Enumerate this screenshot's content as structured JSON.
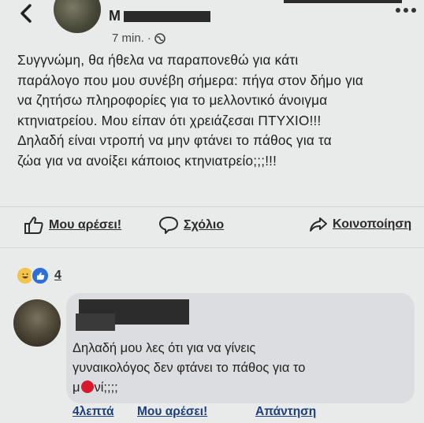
{
  "header": {
    "author_initial": "M",
    "time": "7 min.",
    "separator": "·"
  },
  "post": {
    "lines": [
      "Συγγνώμη, θα ήθελα να παραπονεθώ για κάτι",
      "παράλογο που μου συνέβη σήμερα: πήγα στον δήμο για",
      "να ζητήσω πληροφορίες για το μελλοντικό άνοιγμα",
      "κτηνιατρείου. Μου είπαν ότι χρειάζεσαι ΠΤΥΧΙΟ!!!",
      "Δηλαδή είναι ντροπή να μην φτάνει το πάθος για τα",
      "ζώα για να ανοίξει κάποιος κτηνιατρείο;;;!!!"
    ]
  },
  "actions": {
    "like_label": "Μου αρέσει!",
    "comment_label": "Σχόλιο",
    "share_label": "Κοινοποίηση"
  },
  "reactions": {
    "count": "4"
  },
  "comment": {
    "line1": "Δηλαδή μου λες ότι για να γίνεις",
    "line2": "γυναικολόγος δεν φτάνει το πάθος για το",
    "line3_start": "μ",
    "line3_end": "νί;;;;",
    "time_label": "4λεπτά",
    "like_label": "Μου αρέσει!",
    "reply_label": "Απάντηση"
  },
  "colors": {
    "background": "#e9eaea",
    "bubble": "#dcdde0",
    "link": "#1d3f7a",
    "like_reaction": "#2d6fd6",
    "haha_reaction": "#f2c44b"
  }
}
